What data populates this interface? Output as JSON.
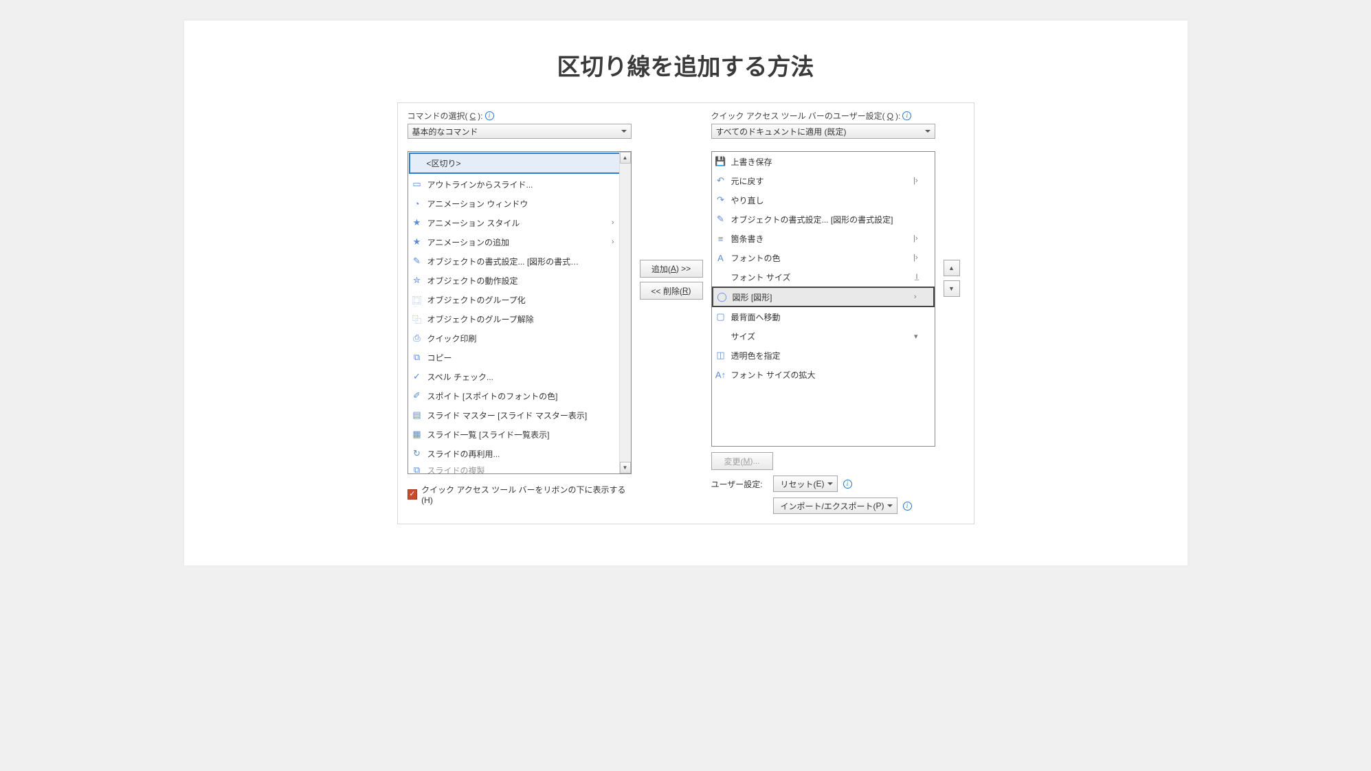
{
  "page_title": "区切り線を追加する方法",
  "left": {
    "label_prefix": "コマンドの選択(",
    "label_key": "C",
    "label_suffix": "):",
    "combo_value": "基本的なコマンド",
    "items": [
      {
        "id": "separator",
        "label": "<区切り>",
        "selected": true
      },
      {
        "id": "outline-to-slide",
        "label": "アウトラインからスライド...",
        "icon": "page-icon"
      },
      {
        "id": "animation-window",
        "label": "アニメーション ウィンドウ",
        "icon": "clock-icon"
      },
      {
        "id": "animation-style",
        "label": "アニメーション スタイル",
        "icon": "star-icon",
        "submenu": true
      },
      {
        "id": "add-animation",
        "label": "アニメーションの追加",
        "icon": "star-icon",
        "submenu": true
      },
      {
        "id": "object-format",
        "label": "オブジェクトの書式設定... [図形の書式…",
        "icon": "format-icon"
      },
      {
        "id": "object-action",
        "label": "オブジェクトの動作設定",
        "icon": "star-box-icon"
      },
      {
        "id": "group",
        "label": "オブジェクトのグループ化",
        "icon": "group-icon"
      },
      {
        "id": "ungroup",
        "label": "オブジェクトのグループ解除",
        "icon": "ungroup-icon"
      },
      {
        "id": "quick-print",
        "label": "クイック印刷",
        "icon": "printer-icon"
      },
      {
        "id": "copy",
        "label": "コピー",
        "icon": "copy-icon"
      },
      {
        "id": "spell",
        "label": "スペル チェック...",
        "icon": "spell-icon"
      },
      {
        "id": "eyedropper",
        "label": "スポイト [スポイトのフォントの色]",
        "icon": "eyedropper-icon"
      },
      {
        "id": "slide-master",
        "label": "スライド マスター [スライド マスター表示]",
        "icon": "master-icon"
      },
      {
        "id": "slide-sorter",
        "label": "スライド一覧 [スライド一覧表示]",
        "icon": "sorter-icon"
      },
      {
        "id": "reuse-slides",
        "label": "スライドの再利用...",
        "icon": "reuse-icon"
      },
      {
        "id": "duplicate-slide",
        "label": "スライドの複製",
        "icon": "dup-icon",
        "cut": true
      }
    ]
  },
  "right": {
    "label_prefix": "クイック アクセス ツール バーのユーザー設定(",
    "label_key": "Q",
    "label_suffix": "):",
    "combo_value": "すべてのドキュメントに適用 (既定)",
    "items": [
      {
        "id": "save",
        "label": "上書き保存",
        "icon": "save-icon"
      },
      {
        "id": "undo",
        "label": "元に戻す",
        "icon": "undo-icon",
        "split": true
      },
      {
        "id": "redo",
        "label": "やり直し",
        "icon": "redo-icon"
      },
      {
        "id": "obj-format-r",
        "label": "オブジェクトの書式設定... [図形の書式設定]",
        "icon": "format-icon"
      },
      {
        "id": "bullets",
        "label": "箇条書き",
        "icon": "list-icon",
        "split": true
      },
      {
        "id": "font-color",
        "label": "フォントの色",
        "icon": "font-color-icon",
        "split": true
      },
      {
        "id": "font-size",
        "label": "フォント サイズ",
        "icon": "",
        "input_ind": true
      },
      {
        "id": "shapes",
        "label": "図形 [図形]",
        "icon": "shapes-icon",
        "selected": true,
        "submenu": true
      },
      {
        "id": "send-back",
        "label": "最背面へ移動",
        "icon": "back-icon"
      },
      {
        "id": "size",
        "label": "サイズ",
        "icon": "",
        "box_ind": true
      },
      {
        "id": "transparent",
        "label": "透明色を指定",
        "icon": "transparent-icon"
      },
      {
        "id": "grow-font",
        "label": "フォント サイズの拡大",
        "icon": "grow-font-icon"
      }
    ]
  },
  "middle": {
    "add_prefix": "追加(",
    "add_key": "A",
    "add_suffix": ") >>",
    "remove_prefix": "<< 削除(",
    "remove_key": "R",
    "remove_suffix": ")"
  },
  "below": {
    "modify_prefix": "変更(",
    "modify_key": "M",
    "modify_suffix": ")...",
    "custom_label": "ユーザー設定:",
    "reset_prefix": "リセット(",
    "reset_key": "E",
    "reset_suffix": ")",
    "import_export_prefix": "インポート/エクスポート(",
    "import_export_key": "P",
    "import_export_suffix": ")"
  },
  "checkbox": {
    "prefix": "クイック アクセス ツール バーをリボンの下に表示する(",
    "key": "H",
    "suffix": ")"
  }
}
